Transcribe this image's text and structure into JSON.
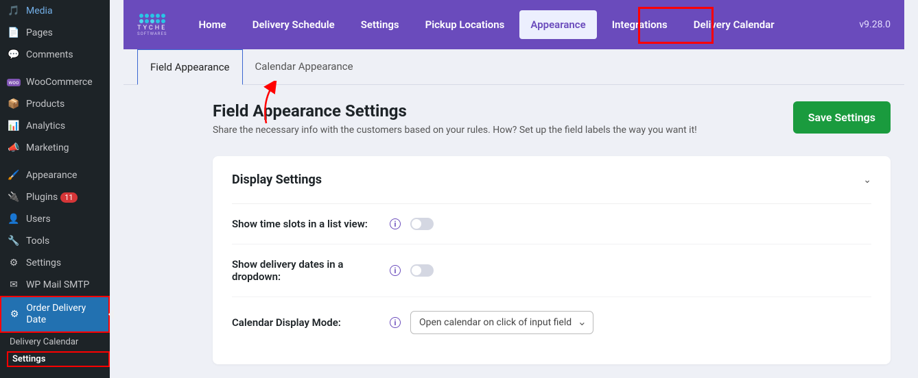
{
  "sidebar": {
    "items": [
      {
        "label": "Media",
        "icon": "media"
      },
      {
        "label": "Pages",
        "icon": "pages"
      },
      {
        "label": "Comments",
        "icon": "comments"
      },
      {
        "label": "WooCommerce",
        "icon": "woo"
      },
      {
        "label": "Products",
        "icon": "products"
      },
      {
        "label": "Analytics",
        "icon": "analytics"
      },
      {
        "label": "Marketing",
        "icon": "marketing"
      },
      {
        "label": "Appearance",
        "icon": "appearance"
      },
      {
        "label": "Plugins",
        "icon": "plugins",
        "badge": "11"
      },
      {
        "label": "Users",
        "icon": "users"
      },
      {
        "label": "Tools",
        "icon": "tools"
      },
      {
        "label": "Settings",
        "icon": "settings"
      },
      {
        "label": "WP Mail SMTP",
        "icon": "mail"
      },
      {
        "label": "Order Delivery Date",
        "icon": "gear",
        "active": true
      }
    ],
    "sub": [
      {
        "label": "Delivery Calendar"
      },
      {
        "label": "Settings",
        "highlighted": true
      }
    ]
  },
  "logo": {
    "text": "TYCHE",
    "sub": "SOFTWARES"
  },
  "nav": {
    "items": [
      {
        "label": "Home"
      },
      {
        "label": "Delivery Schedule"
      },
      {
        "label": "Settings"
      },
      {
        "label": "Pickup Locations"
      },
      {
        "label": "Appearance",
        "active": true,
        "highlighted": true
      },
      {
        "label": "Integrations"
      },
      {
        "label": "Delivery Calendar"
      }
    ],
    "version": "v9.28.0"
  },
  "subtabs": [
    {
      "label": "Field Appearance",
      "active": true
    },
    {
      "label": "Calendar Appearance"
    }
  ],
  "page": {
    "title": "Field Appearance Settings",
    "desc": "Share the necessary info with the customers based on your rules. How? Set up the field labels the way you want it!",
    "save": "Save Settings"
  },
  "panel": {
    "title": "Display Settings",
    "rows": [
      {
        "label": "Show time slots in a list view:",
        "type": "toggle"
      },
      {
        "label": "Show delivery dates in a dropdown:",
        "type": "toggle"
      },
      {
        "label": "Calendar Display Mode:",
        "type": "select",
        "value": "Open calendar on click of input field"
      }
    ]
  }
}
